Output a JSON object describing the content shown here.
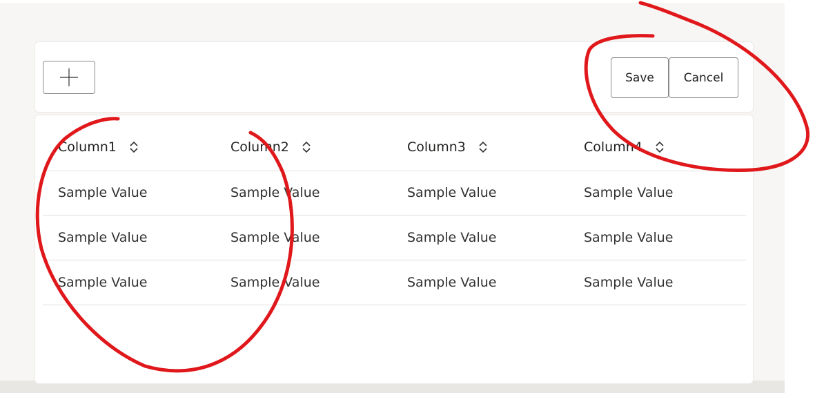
{
  "toolbar": {
    "add_icon": "plus-icon",
    "save_label": "Save",
    "cancel_label": "Cancel"
  },
  "table": {
    "columns": [
      {
        "label": "Column1",
        "sort_icon": "sort-chevrons-icon"
      },
      {
        "label": "Column2",
        "sort_icon": "sort-chevrons-icon"
      },
      {
        "label": "Column3",
        "sort_icon": "sort-chevrons-icon"
      },
      {
        "label": "Column4",
        "sort_icon": "sort-chevrons-icon"
      }
    ],
    "rows": [
      [
        "Sample Value",
        "Sample Value",
        "Sample Value",
        "Sample Value"
      ],
      [
        "Sample Value",
        "Sample Value",
        "Sample Value",
        "Sample Value"
      ],
      [
        "Sample Value",
        "Sample Value",
        "Sample Value",
        "Sample Value"
      ]
    ]
  },
  "colors": {
    "annotation": "#e0181b",
    "background": "#f7f6f4",
    "border": "#8a8886"
  }
}
